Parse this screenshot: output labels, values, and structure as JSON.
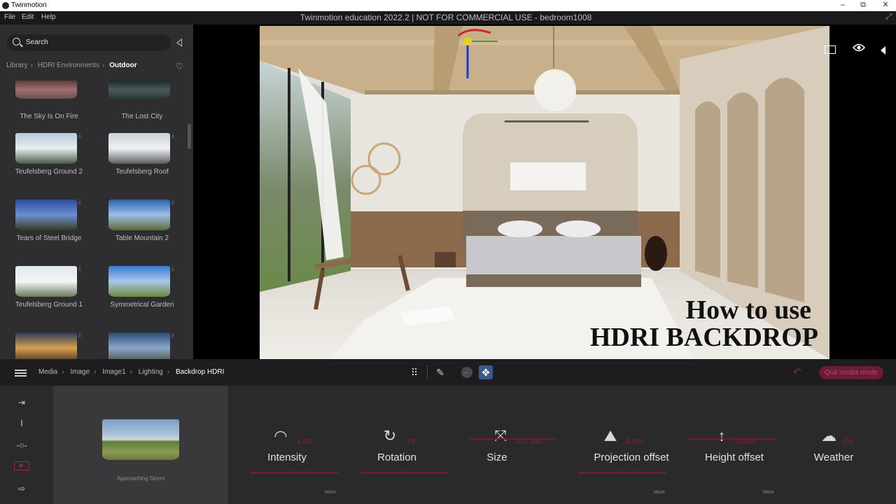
{
  "os": {
    "app_name": "Twinmotion",
    "minimize": "–",
    "restore": "⧉",
    "close": "✕"
  },
  "menu": {
    "items": [
      "File",
      "Edit",
      "Help"
    ],
    "doc_title": "Twinmotion education 2022.2 | NOT FOR COMMERCIAL USE - bedroom1008",
    "expand_icon": "⤢"
  },
  "library": {
    "search_label": "Search",
    "breadcrumb": [
      "Library",
      "HDRI Environments",
      "Outdoor"
    ],
    "items": [
      {
        "name": "The Sky Is On Fire",
        "colors": [
          "#5a3a3a",
          "#a07070",
          "#6a5050"
        ]
      },
      {
        "name": "The Lost City",
        "colors": [
          "#1e2a2c",
          "#4a5a5c",
          "#2a3a30"
        ]
      },
      {
        "name": "Teufelsberg Ground 2",
        "colors": [
          "#b8c8d8",
          "#e8eef2",
          "#4a5a44"
        ]
      },
      {
        "name": "Teufelsberg Roof",
        "colors": [
          "#c8d0d8",
          "#eef2f4",
          "#5a5e5a"
        ]
      },
      {
        "name": "Tears of Steel Bridge",
        "colors": [
          "#2a4aa0",
          "#6a90d0",
          "#3a3a20"
        ]
      },
      {
        "name": "Table Mountain 2",
        "colors": [
          "#2a60b0",
          "#9cc0e8",
          "#5a6a3a"
        ]
      },
      {
        "name": "Teufelsberg Ground 1",
        "colors": [
          "#dfe6ec",
          "#f4f6f8",
          "#6a7a5a"
        ]
      },
      {
        "name": "Symmetrical Garden",
        "colors": [
          "#3a7ad0",
          "#a8c8ec",
          "#6a8a3a"
        ]
      },
      {
        "name": "",
        "colors": [
          "#2a3a5a",
          "#d8a050",
          "#3a2a1a"
        ]
      },
      {
        "name": "",
        "colors": [
          "#2a4a7a",
          "#8aa8c8",
          "#4a4a3a"
        ]
      }
    ]
  },
  "viewport": {
    "overlay_line1": "How to use",
    "overlay_line2": "HDRI BACKDROP"
  },
  "toolbar": {
    "breadcrumb": [
      "Media",
      "Image",
      "Image1",
      "Lighting",
      "Backdrop HDRI"
    ],
    "quit_label": "Quit media mode"
  },
  "props": {
    "preview_name": "Approaching Storm",
    "params": [
      {
        "label": "Intensity",
        "value": "1.48"
      },
      {
        "label": "Rotation",
        "value": "18°"
      },
      {
        "label": "Size",
        "value": "221.9m"
      },
      {
        "label": "Projection offset",
        "value": "3.0m"
      },
      {
        "label": "Height offset",
        "value": "-0.0m"
      },
      {
        "label": "Weather",
        "value": "On"
      }
    ],
    "more_label": "More"
  },
  "colors": {
    "accent": "#6b1c3b",
    "panel": "#2e2e30",
    "toolbar": "#1d1d1f"
  }
}
